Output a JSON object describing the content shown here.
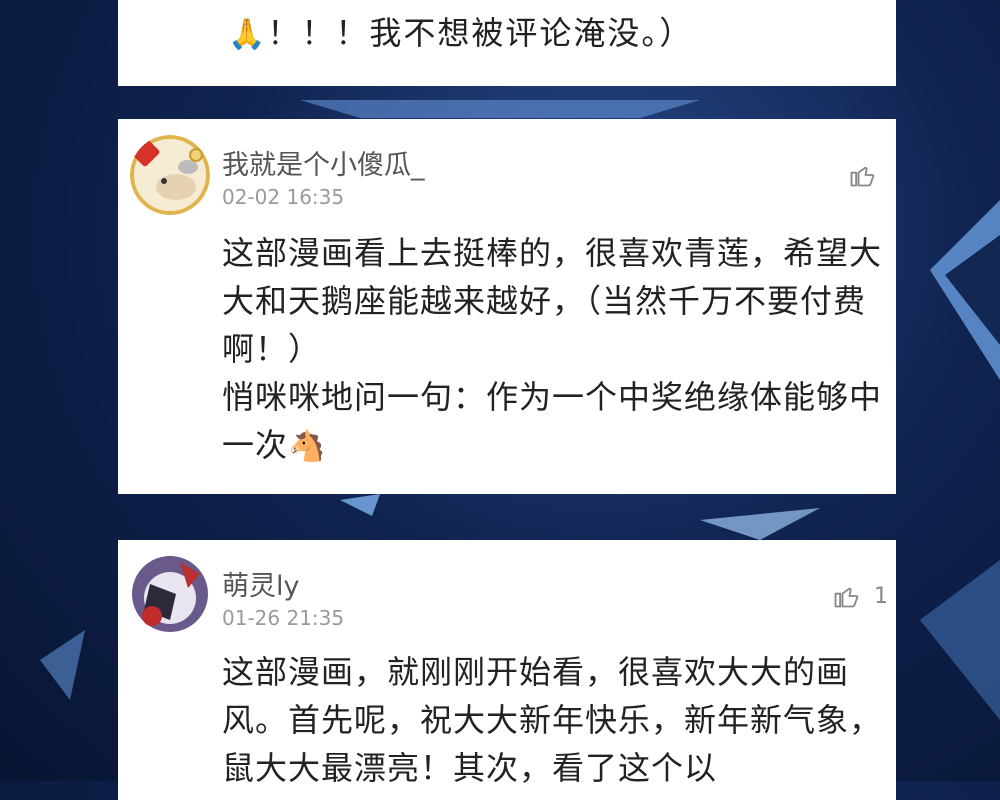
{
  "top_comment": {
    "text_tail": "！！！我不想被评论淹没。）",
    "emoji": "🙏"
  },
  "comments": [
    {
      "username": "我就是个小傻瓜_",
      "timestamp": "02-02 16:35",
      "likes": "",
      "paragraph_1": "这部漫画看上去挺棒的，很喜欢青莲，希望大大和天鹅座能越来越好，（当然千万不要付费啊！）",
      "paragraph_2": "悄咪咪地问一句：作为一个中奖绝缘体能够中一次",
      "paragraph_2_emoji": "🐴"
    },
    {
      "username": "萌灵ly",
      "timestamp": "01-26 21:35",
      "likes": "1",
      "paragraph_1": "这部漫画，就刚刚开始看，很喜欢大大的画风。首先呢，祝大大新年快乐，新年新气象，鼠大大最漂亮！其次，看了这个以"
    }
  ],
  "icons": {
    "like": "thumbs-up-icon"
  }
}
